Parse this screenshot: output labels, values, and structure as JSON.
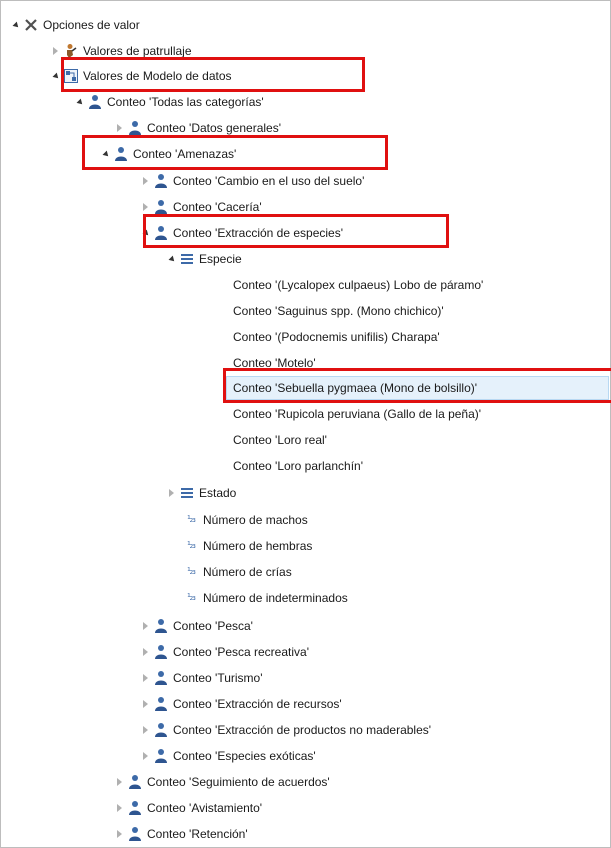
{
  "tree": {
    "root": "Opciones de valor",
    "patrol": "Valores de patrullaje",
    "datamodel": "Valores de Modelo de datos",
    "all": "Conteo 'Todas las categorías'",
    "general": "Conteo 'Datos generales'",
    "threats": "Conteo 'Amenazas'",
    "landuse": "Conteo 'Cambio en el uso del suelo'",
    "hunting": "Conteo 'Cacería'",
    "extraction": "Conteo 'Extracción de  especies'",
    "species": "Especie",
    "species_items": [
      "Conteo '(Lycalopex culpaeus) Lobo de páramo'",
      "Conteo 'Saguinus spp. (Mono chichico)'",
      "Conteo '(Podocnemis unifilis) Charapa'",
      "Conteo 'Motelo'",
      "Conteo 'Sebuella pygmaea (Mono de bolsillo)'",
      "Conteo 'Rupicola peruviana (Gallo de la peña)'",
      "Conteo 'Loro real'",
      "Conteo 'Loro parlanchín'"
    ],
    "state": "Estado",
    "numbers": [
      "Número de machos",
      "Número de hembras",
      "Número de crías",
      "Número de indeterminados"
    ],
    "threat_children": [
      "Conteo 'Pesca'",
      "Conteo 'Pesca recreativa'",
      "Conteo 'Turismo'",
      "Conteo 'Extracción de recursos'",
      "Conteo 'Extracción de productos no maderables'",
      "Conteo 'Especies exóticas'"
    ],
    "level2": [
      "Conteo 'Seguimiento de acuerdos'",
      "Conteo 'Avistamiento'",
      "Conteo 'Retención'"
    ]
  },
  "colors": {
    "highlight": "#e01010",
    "selection": "#e5f1fb",
    "icon": "#3d6aa8"
  },
  "icons": {
    "root": "x-icon",
    "patrol": "patrol-icon",
    "datamodel": "datamodel-icon",
    "count": "person-count-icon",
    "list": "list-icon",
    "number": "number-icon"
  }
}
